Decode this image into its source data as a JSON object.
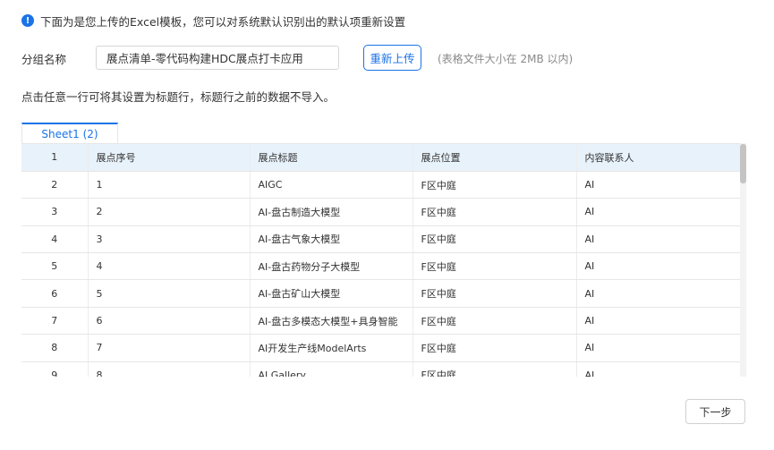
{
  "notice": {
    "text": "下面为是您上传的Excel模板，您可以对系统默认识别出的默认项重新设置",
    "icon": "info-icon"
  },
  "group": {
    "label": "分组名称",
    "value": "展点清单-零代码构建HDC展点打卡应用"
  },
  "reupload_label": "重新上传",
  "hint": "(表格文件大小在 2MB 以内)",
  "instruction": "点击任意一行可将其设置为标题行，标题行之前的数据不导入。",
  "sheet_tab": "Sheet1 (2)",
  "rows": [
    {
      "idx": "1",
      "c1": "展点序号",
      "c2": "展点标题",
      "c3": "展点位置",
      "c4": "内容联系人"
    },
    {
      "idx": "2",
      "c1": "1",
      "c2": "AIGC",
      "c3": "F区中庭",
      "c4": "AI"
    },
    {
      "idx": "3",
      "c1": "2",
      "c2": "AI-盘古制造大模型",
      "c3": "F区中庭",
      "c4": "AI"
    },
    {
      "idx": "4",
      "c1": "3",
      "c2": "AI-盘古气象大模型",
      "c3": "F区中庭",
      "c4": "AI"
    },
    {
      "idx": "5",
      "c1": "4",
      "c2": "AI-盘古药物分子大模型",
      "c3": "F区中庭",
      "c4": "AI"
    },
    {
      "idx": "6",
      "c1": "5",
      "c2": "AI-盘古矿山大模型",
      "c3": "F区中庭",
      "c4": "AI"
    },
    {
      "idx": "7",
      "c1": "6",
      "c2": "AI-盘古多模态大模型+具身智能",
      "c3": "F区中庭",
      "c4": "AI"
    },
    {
      "idx": "8",
      "c1": "7",
      "c2": "AI开发生产线ModelArts",
      "c3": "F区中庭",
      "c4": "AI"
    },
    {
      "idx": "9",
      "c1": "8",
      "c2": "AI Gallery",
      "c3": "F区中庭",
      "c4": "AI"
    }
  ],
  "next_label": "下一步",
  "colors": {
    "accent": "#1a73e8",
    "header_bg": "#e8f2fb"
  }
}
